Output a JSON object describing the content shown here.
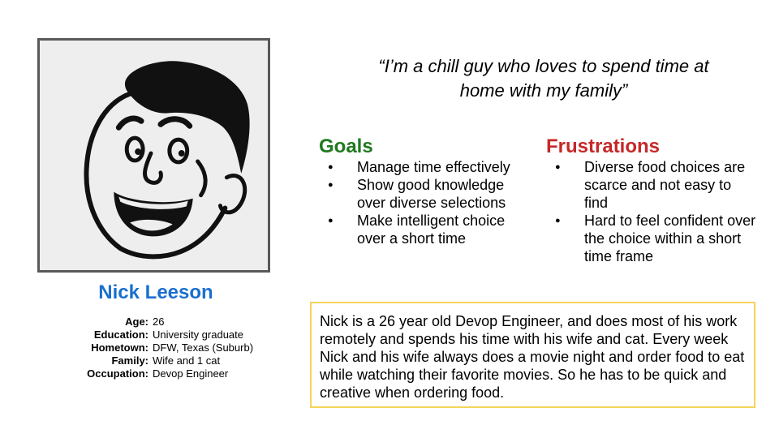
{
  "persona": {
    "portrait_icon": "cartoon-man-face",
    "name": "Nick Leeson",
    "facts": [
      {
        "label": "Age:",
        "value": "26"
      },
      {
        "label": "Education:",
        "value": "University graduate"
      },
      {
        "label": "Hometown:",
        "value": "DFW, Texas (Suburb)"
      },
      {
        "label": "Family:",
        "value": "Wife and 1 cat"
      },
      {
        "label": "Occupation:",
        "value": "Devop Engineer"
      }
    ]
  },
  "quote": {
    "line1": "“I’m a chill guy who loves to spend time at",
    "line2": "home with my family”"
  },
  "goals": {
    "heading": "Goals",
    "color": "#1f7a1f",
    "items": [
      "Manage time effectively",
      "Show good knowledge over diverse selections",
      "Make intelligent choice over a short time"
    ]
  },
  "frustrations": {
    "heading": "Frustrations",
    "color": "#c62828",
    "items": [
      "Diverse food choices are scarce and not easy to find",
      "Hard to feel confident over the choice within a short time frame"
    ]
  },
  "bio": {
    "text": "Nick is a 26 year old Devop Engineer, and does most of his work remotely and spends his time with his wife and cat. Every week Nick and his wife always does a movie night and order food to eat while watching their favorite movies. So he has to be quick and creative when ordering food.",
    "border_color": "#f3d55a"
  },
  "accent": {
    "name_color": "#1a6fcf"
  }
}
